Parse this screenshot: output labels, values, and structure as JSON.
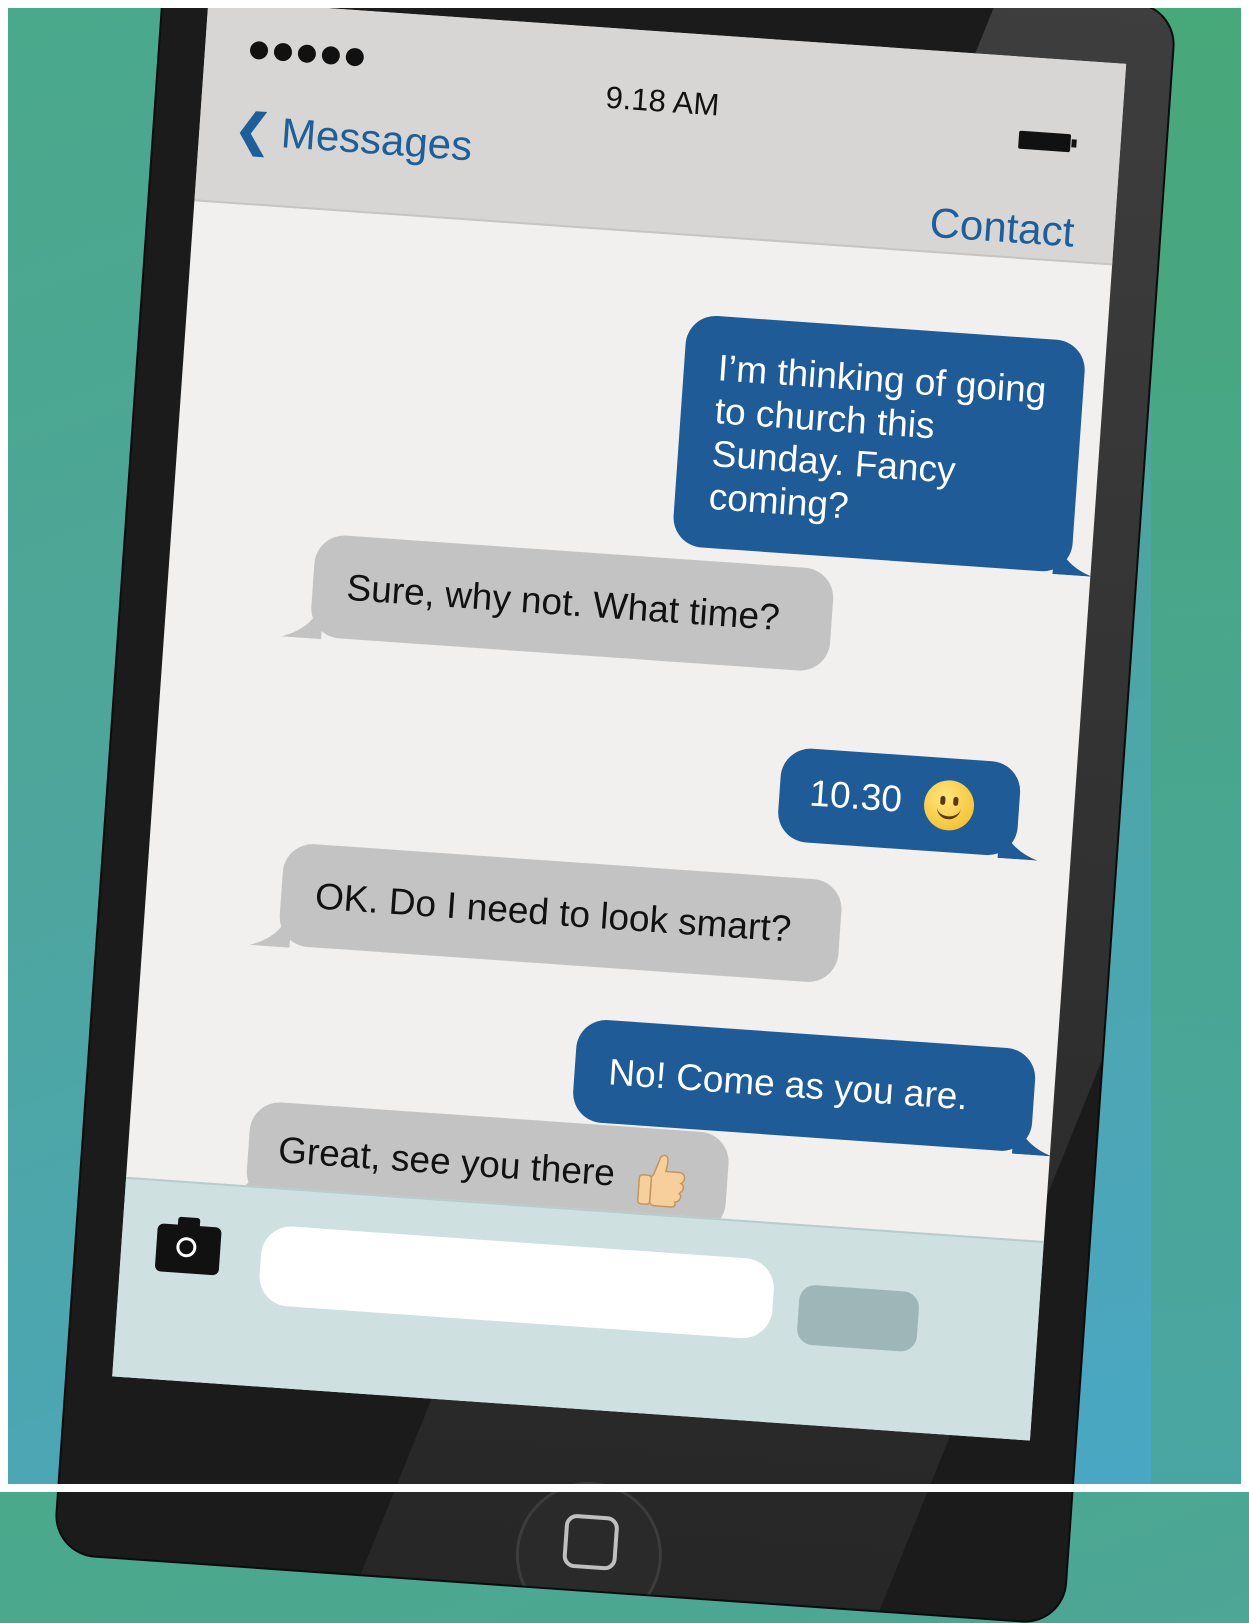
{
  "status_bar": {
    "signal_dots": 5,
    "time": "9.18 AM",
    "battery_icon": "battery-icon"
  },
  "nav": {
    "back_label": "Messages",
    "contact_label": "Contact"
  },
  "messages": [
    {
      "direction": "outgoing",
      "text": "I’m thinking of going to church this Sunday. Fancy coming?"
    },
    {
      "direction": "incoming",
      "text": "Sure, why not. What time?"
    },
    {
      "direction": "outgoing",
      "text": "10.30",
      "emoji": "smile-emoji-icon"
    },
    {
      "direction": "incoming",
      "text": "OK. Do I need to look smart?"
    },
    {
      "direction": "outgoing",
      "text": "No! Come as you are."
    },
    {
      "direction": "incoming",
      "text": "Great, see you there",
      "emoji": "thumbs-up-emoji-icon"
    }
  ],
  "composer": {
    "camera_icon": "camera-icon",
    "input_value": "",
    "send_label": ""
  },
  "colors": {
    "outgoing_bubble": "#1f5b96",
    "incoming_bubble": "#c3c3c3",
    "link_blue": "#1e5f99"
  }
}
